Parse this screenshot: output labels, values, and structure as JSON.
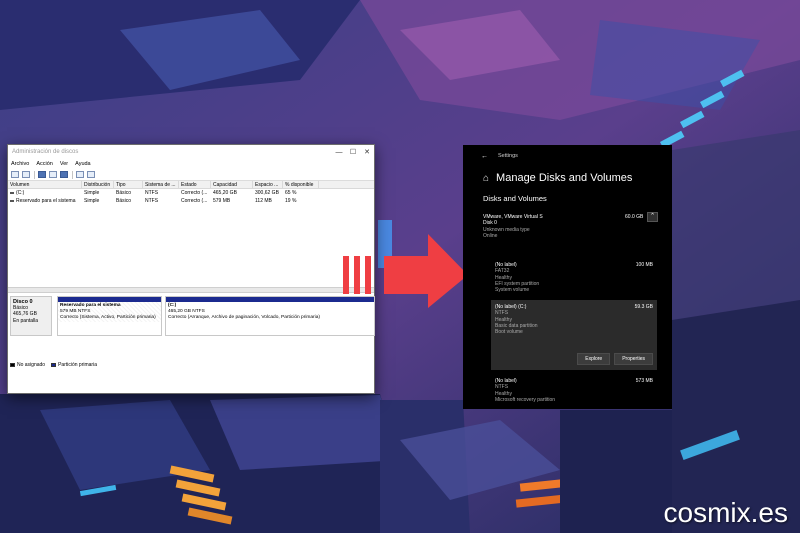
{
  "disk_management": {
    "title": "Administración de discos",
    "window_controls": {
      "minimize": "—",
      "maximize": "☐",
      "close": "✕"
    },
    "menu": [
      "Archivo",
      "Acción",
      "Ver",
      "Ayuda"
    ],
    "columns": [
      "Volumen",
      "Distribución",
      "Tipo",
      "Sistema de ...",
      "Estado",
      "Capacidad",
      "Espacio ...",
      "% disponible"
    ],
    "rows": [
      [
        "(C:)",
        "Simple",
        "Básico",
        "NTFS",
        "Correcto (...",
        "465,20 GB",
        "300,62 GB",
        "65 %"
      ],
      [
        "Reservado para el sistema",
        "Simple",
        "Básico",
        "NTFS",
        "Correcto (...",
        "579 MB",
        "112 MB",
        "19 %"
      ]
    ],
    "disk": {
      "name": "Disco 0",
      "type": "Básico",
      "size": "465,76 GB",
      "status": "En pantalla"
    },
    "partitions": [
      {
        "name": "Reservado para el sistema",
        "size": "579 MB NTFS",
        "status": "Correcto (Sistema, Activo, Partición primaria)"
      },
      {
        "name": "(C:)",
        "size": "465,20 GB NTFS",
        "status": "Correcto (Arranque, Archivo de paginación, Volcado, Partición primaria)"
      }
    ],
    "legend": [
      "No asignado",
      "Partición primaria"
    ]
  },
  "settings": {
    "back_icon": "←",
    "app_title": "Settings",
    "home_icon": "⌂",
    "page_title": "Manage Disks and Volumes",
    "section_title": "Disks and Volumes",
    "disk": {
      "name": "VMware, VMware Virtual S",
      "index": "Disk 0",
      "media": "Unknown media type",
      "status": "Online",
      "size": "60.0 GB",
      "collapse_icon": "⌃"
    },
    "volumes": [
      {
        "label": "(No label)",
        "fs": "FAT32",
        "health": "Healthy",
        "partition": "EFI system partition",
        "role": "System volume",
        "size": "100 MB"
      },
      {
        "label": "(No label) (C:)",
        "fs": "NTFS",
        "health": "Healthy",
        "partition": "Basic data partition",
        "role": "Boot volume",
        "size": "59.3 GB"
      },
      {
        "label": "(No label)",
        "fs": "NTFS",
        "health": "Healthy",
        "partition": "Microsoft recovery partition",
        "size": "573 MB"
      }
    ],
    "buttons": {
      "explore": "Explore",
      "properties": "Properties"
    }
  },
  "watermark": "cosmix.es",
  "colors": {
    "arrow": "#ef3e43",
    "partition_bar": "#1b2a8f",
    "settings_bg": "#000000",
    "selected_volume": "#2b2b2b"
  }
}
